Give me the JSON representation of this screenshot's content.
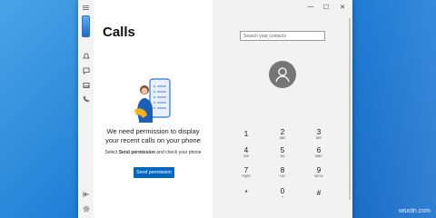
{
  "page": {
    "title": "Calls"
  },
  "permission": {
    "message_line1": "We need permission to display",
    "message_line2": "your recent calls on your phone",
    "sub_prefix": "Select",
    "sub_bold": "Send permission",
    "sub_suffix": "and check your phone",
    "button_label": "Send permission"
  },
  "search": {
    "placeholder": "Search your contacts"
  },
  "chrome": {
    "minimize": "—",
    "maximize": "☐",
    "close": "✕"
  },
  "dialpad": [
    {
      "digit": "1",
      "letters": ""
    },
    {
      "digit": "2",
      "letters": "ABC"
    },
    {
      "digit": "3",
      "letters": "DEF"
    },
    {
      "digit": "4",
      "letters": "GHI"
    },
    {
      "digit": "5",
      "letters": "JKL"
    },
    {
      "digit": "6",
      "letters": "MNO"
    },
    {
      "digit": "7",
      "letters": "PQRS"
    },
    {
      "digit": "8",
      "letters": "TUV"
    },
    {
      "digit": "9",
      "letters": "WXYZ"
    },
    {
      "digit": "*",
      "letters": ""
    },
    {
      "digit": "0",
      "letters": "+"
    },
    {
      "digit": "#",
      "letters": ""
    }
  ],
  "watermark": {
    "text": "wsxdn.com"
  },
  "colors": {
    "accent": "#0067c0",
    "avatar": "#767676",
    "desktop": "#1f7fd6"
  }
}
